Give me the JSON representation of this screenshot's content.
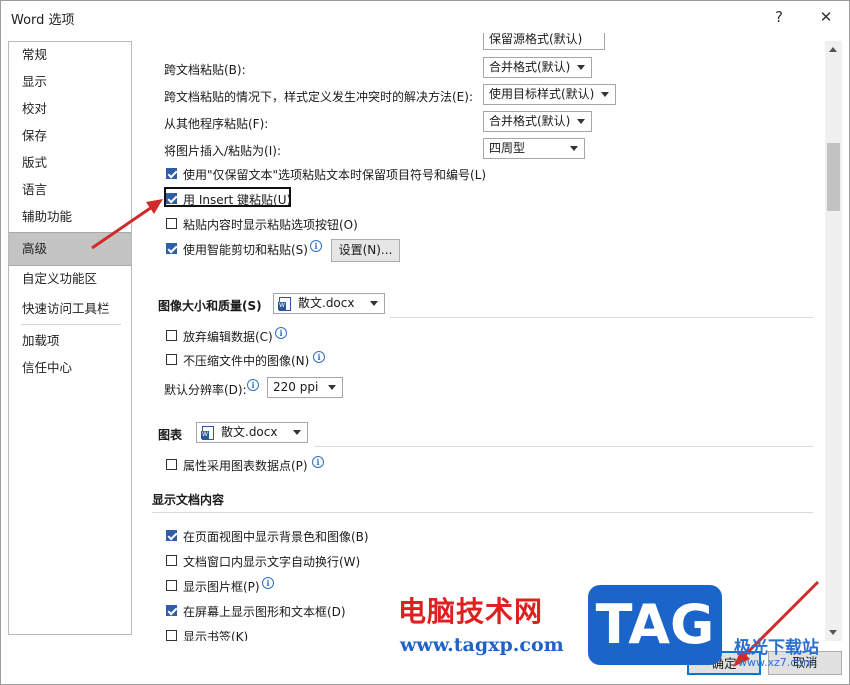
{
  "window": {
    "title": "Word 选项",
    "help_label": "?",
    "close_label": "✕"
  },
  "nav": {
    "items": [
      {
        "label": "常规"
      },
      {
        "label": "显示"
      },
      {
        "label": "校对"
      },
      {
        "label": "保存"
      },
      {
        "label": "版式"
      },
      {
        "label": "语言"
      },
      {
        "label": "辅助功能"
      },
      {
        "label": "高级",
        "active": true
      },
      {
        "label": "自定义功能区"
      },
      {
        "label": "快速访问工具栏"
      },
      {
        "label": "加载项"
      },
      {
        "label": "信任中心"
      }
    ]
  },
  "paste": {
    "top_value": "保留源格式(默认)",
    "cross_doc_label": "跨文档粘贴(B):",
    "cross_doc_value": "合并格式(默认)",
    "conflict_label": "跨文档粘贴的情况下，样式定义发生冲突时的解决方法(E):",
    "conflict_value": "使用目标样式(默认)",
    "other_prog_label": "从其他程序粘贴(F):",
    "other_prog_value": "合并格式(默认)",
    "picture_label": "将图片插入/粘贴为(I):",
    "picture_value": "四周型",
    "keep_bullets_label": "使用\"仅保留文本\"选项粘贴文本时保留项目符号和编号(L)",
    "insert_key_label": "用 Insert 键粘贴(U)",
    "show_paste_btn_label": "粘贴内容时显示粘贴选项按钮(O)",
    "smart_cut_label": "使用智能剪切和粘贴(S)",
    "settings_button": "设置(N)..."
  },
  "image": {
    "section_label": "图像大小和质量(S)",
    "doc_value": "散文.docx",
    "discard_label": "放弃编辑数据(C)",
    "nocompress_label": "不压缩文件中的图像(N)",
    "resolution_label": "默认分辨率(D):",
    "resolution_value": "220 ppi"
  },
  "chart": {
    "section_label": "图表",
    "doc_value": "散文.docx",
    "props_label": "属性采用图表数据点(P)"
  },
  "display": {
    "section_label": "显示文档内容",
    "bg_label": "在页面视图中显示背景色和图像(B)",
    "wrap_label": "文档窗口内显示文字自动换行(W)",
    "placeholder_label": "显示图片框(P)",
    "drawings_label": "在屏幕上显示图形和文本框(D)",
    "bookmarks_label": "显示书签(K)"
  },
  "footer": {
    "ok_label": "确定",
    "cancel_label": "取消"
  },
  "watermark": {
    "site_name": "电脑技术网",
    "site_url": "www.tagxp.com",
    "logo_text": "TAG",
    "extra_name": "极光下载站",
    "extra_url": "www.xz7.com"
  },
  "colors": {
    "accent": "#2e5ea8",
    "arrow": "#d12a2a",
    "logo": "#1b64c9"
  }
}
